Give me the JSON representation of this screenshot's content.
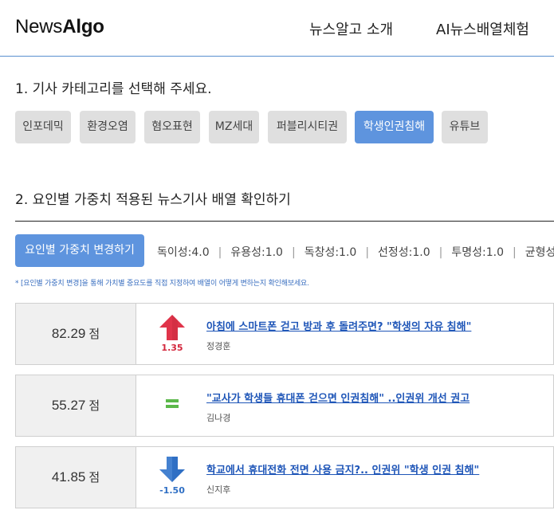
{
  "header": {
    "logo_regular": "News",
    "logo_bold": "Algo",
    "nav": [
      "뉴스알고 소개",
      "AI뉴스배열체험"
    ]
  },
  "section1": {
    "title": "1. 기사 카테고리를 선택해 주세요.",
    "categories": [
      {
        "label": "인포데믹",
        "selected": false
      },
      {
        "label": "환경오염",
        "selected": false
      },
      {
        "label": "혐오표현",
        "selected": false
      },
      {
        "label": "MZ세대",
        "selected": false
      },
      {
        "label": "퍼블리시티권",
        "selected": false
      },
      {
        "label": "학생인권침해",
        "selected": true
      },
      {
        "label": "유튜브",
        "selected": false
      }
    ]
  },
  "section2": {
    "title": "2. 요인별 가중치 적용된 뉴스기사 배열 확인하기",
    "weight_button": "요인별 가중치 변경하기",
    "weights": [
      {
        "label": "독이성",
        "value": "4.0"
      },
      {
        "label": "유용성",
        "value": "1.0"
      },
      {
        "label": "독창성",
        "value": "1.0"
      },
      {
        "label": "선정성",
        "value": "1.0"
      },
      {
        "label": "투명성",
        "value": "1.0"
      },
      {
        "label": "균형성",
        "value": ""
      }
    ],
    "note": "* [요인별 가중치 변경]을 통해 가치별 중요도를 직접 지정하여 배열이 어떻게 변하는지 확인해보세요."
  },
  "articles": [
    {
      "score": "82.29",
      "unit": "점",
      "trend": "up",
      "delta": "1.35",
      "headline": "아침에 스마트폰 걷고 방과 후 돌려주면? \"학생의 자유 침해\"",
      "author": "정경훈"
    },
    {
      "score": "55.27",
      "unit": "점",
      "trend": "same",
      "delta": "",
      "headline": "\"교사가 학생들 휴대폰 걷으면 인권침해\" ..인권위 개선 권고",
      "author": "김나경"
    },
    {
      "score": "41.85",
      "unit": "점",
      "trend": "down",
      "delta": "-1.50",
      "headline": "학교에서 휴대전화 전면 사용 금지?.. 인권위 \"학생 인권 침해\"",
      "author": "신지후"
    }
  ],
  "colors": {
    "accent": "#5e94de",
    "up": "#e0344a",
    "same": "#5bb84a",
    "down": "#2f6fc4",
    "link": "#1f56b8"
  }
}
